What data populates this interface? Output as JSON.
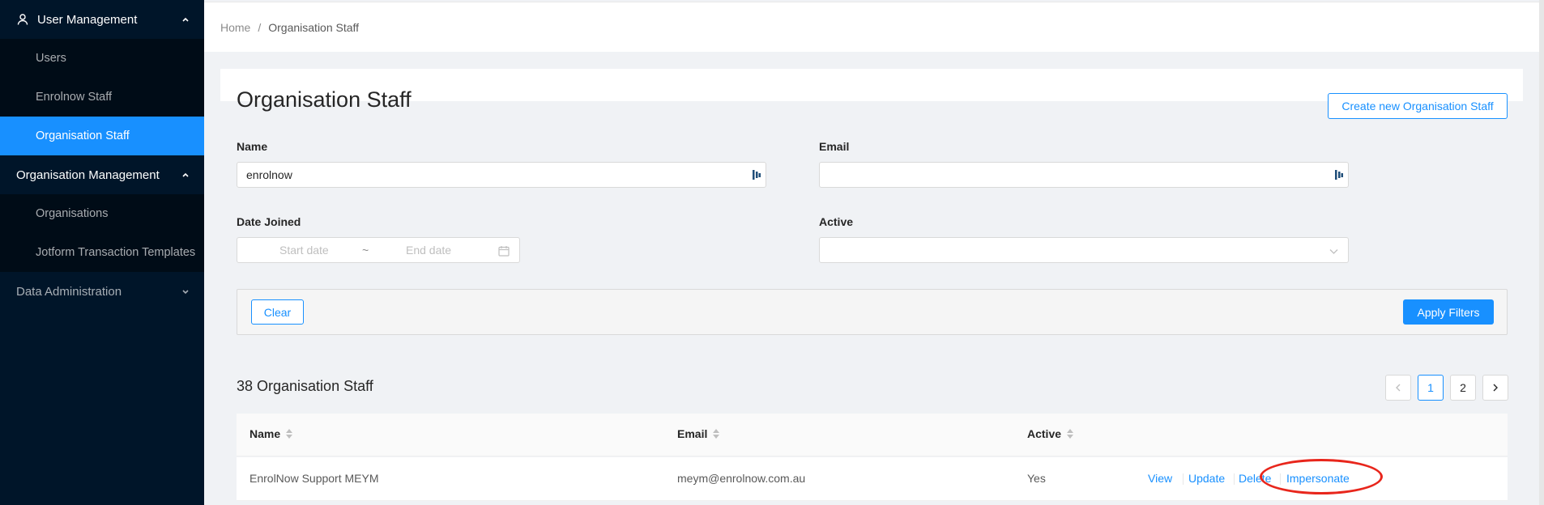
{
  "sidebar": {
    "groups": [
      {
        "label": "User Management",
        "items": [
          "Users",
          "Enrolnow Staff",
          "Organisation Staff"
        ],
        "active_item": "Organisation Staff",
        "expanded": true
      },
      {
        "label": "Organisation Management",
        "items": [
          "Organisations",
          "Jotform Transaction Templates"
        ],
        "expanded": true
      },
      {
        "label": "Data Administration",
        "items": [],
        "expanded": false
      }
    ]
  },
  "breadcrumb": {
    "home": "Home",
    "separator": "/",
    "current": "Organisation Staff"
  },
  "page": {
    "title": "Organisation Staff",
    "create_button": "Create new Organisation Staff"
  },
  "filters": {
    "name_label": "Name",
    "name_value": "enrolnow",
    "email_label": "Email",
    "email_value": "",
    "date_joined_label": "Date Joined",
    "start_placeholder": "Start date",
    "range_separator": "~",
    "end_placeholder": "End date",
    "active_label": "Active",
    "active_value": "",
    "clear_button": "Clear",
    "apply_button": "Apply Filters"
  },
  "results": {
    "count_title": "38 Organisation Staff",
    "pagination": {
      "prev": "<",
      "pages": [
        "1",
        "2"
      ],
      "current": "1",
      "next": ">"
    },
    "columns": [
      "Name",
      "Email",
      "Active"
    ],
    "rows": [
      {
        "name": "EnrolNow Support MEYM",
        "email": "meym@enrolnow.com.au",
        "active": "Yes",
        "actions": [
          "View",
          "Update",
          "Delete",
          "Impersonate"
        ]
      }
    ]
  },
  "colors": {
    "primary": "#1890ff",
    "sidebar_bg": "#001529",
    "highlight": "#e8261c"
  }
}
